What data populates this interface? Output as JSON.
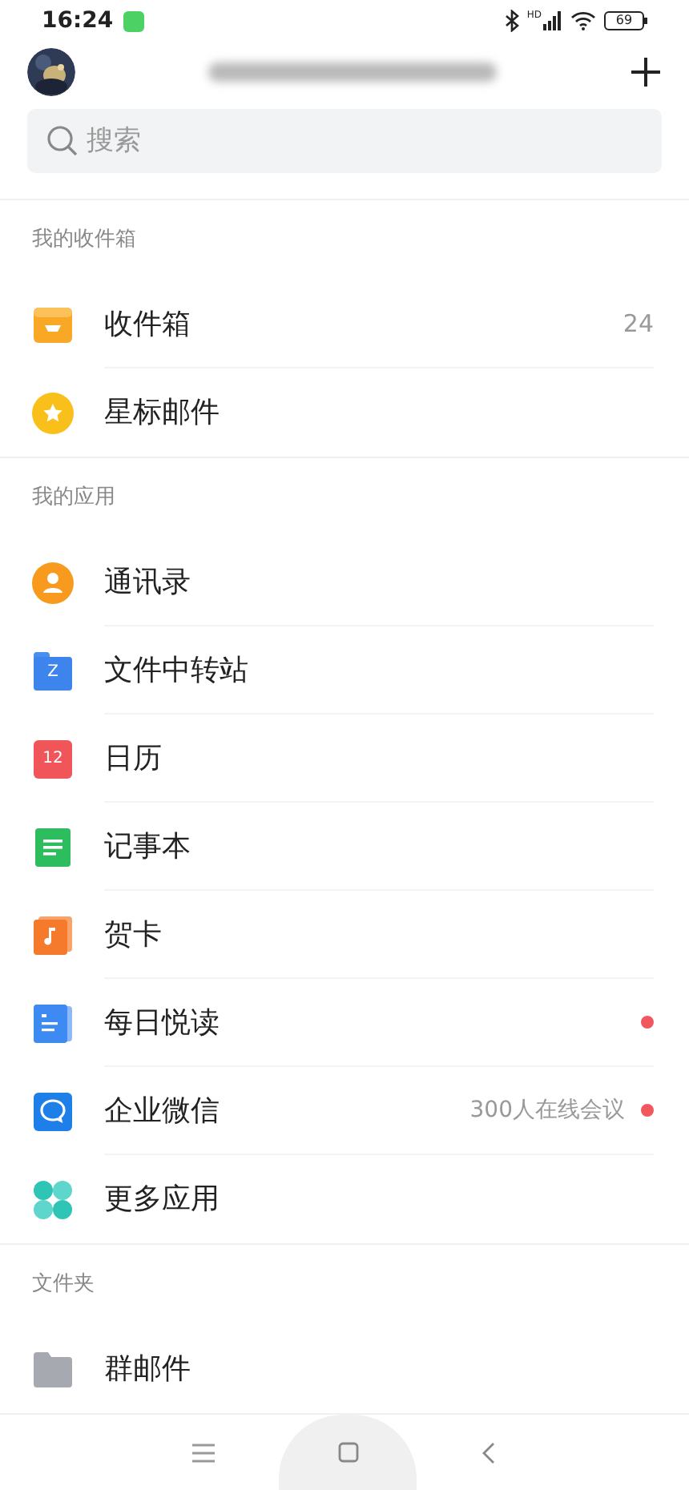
{
  "status_bar": {
    "time": "16:24",
    "signal_label": "HD",
    "battery": "69"
  },
  "search": {
    "placeholder": "搜索"
  },
  "sections": [
    {
      "title": "我的收件箱",
      "items": [
        {
          "kind": "inbox",
          "label": "收件箱",
          "count": "24",
          "dot": false
        },
        {
          "kind": "star",
          "label": "星标邮件",
          "dot": false
        }
      ]
    },
    {
      "title": "我的应用",
      "items": [
        {
          "kind": "contacts",
          "label": "通讯录",
          "dot": false
        },
        {
          "kind": "transfer",
          "icon_text": "Z",
          "label": "文件中转站",
          "dot": false
        },
        {
          "kind": "calendar",
          "icon_text": "12",
          "label": "日历",
          "dot": false
        },
        {
          "kind": "notes",
          "label": "记事本",
          "dot": false
        },
        {
          "kind": "card",
          "label": "贺卡",
          "dot": false
        },
        {
          "kind": "reading",
          "label": "每日悦读",
          "dot": true
        },
        {
          "kind": "wework",
          "label": "企业微信",
          "note": "300人在线会议",
          "dot": true
        },
        {
          "kind": "more",
          "label": "更多应用",
          "dot": false
        }
      ]
    },
    {
      "title": "文件夹",
      "items": [
        {
          "kind": "folder",
          "label": "群邮件",
          "dot": false
        }
      ]
    }
  ]
}
